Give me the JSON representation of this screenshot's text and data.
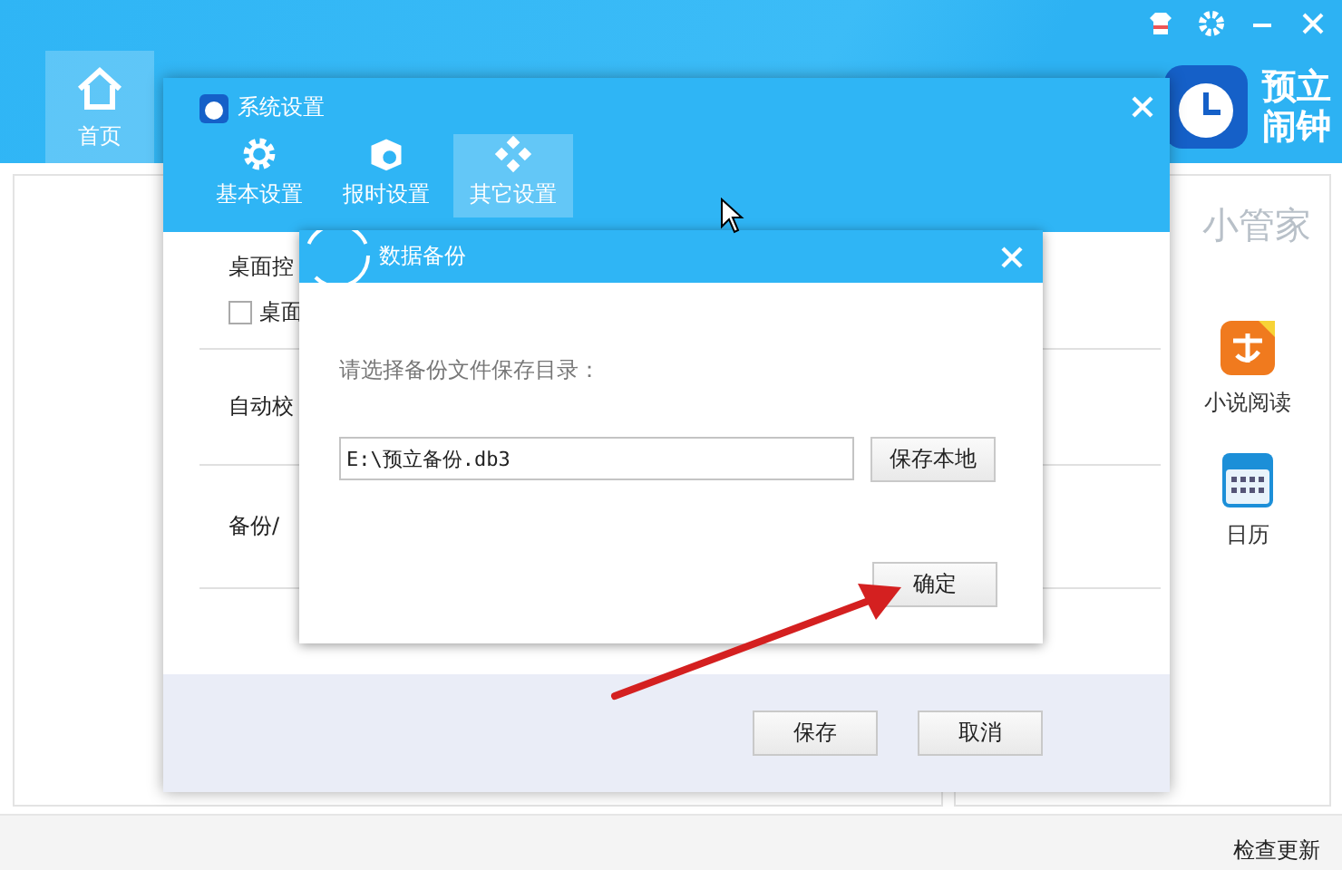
{
  "logo": {
    "lines": [
      "预立",
      "闹钟"
    ]
  },
  "nav": [
    {
      "label": "首页",
      "selected": true
    }
  ],
  "sidebar": {
    "title": "小管家",
    "apps": [
      {
        "kind": "novel",
        "label": "小说阅读"
      },
      {
        "kind": "calendar",
        "label": "日历"
      }
    ]
  },
  "status_bar": {
    "link": "检查更新"
  },
  "settings_dialog": {
    "title": "系统设置",
    "tabs": [
      {
        "kind": "gear",
        "label": "基本设置",
        "selected": false
      },
      {
        "kind": "cube",
        "label": "报时设置",
        "selected": false
      },
      {
        "kind": "diamonds",
        "label": "其它设置",
        "selected": true
      }
    ],
    "sections": [
      {
        "label": "桌面控",
        "checkbox": {
          "label": "桌面",
          "checked": false
        }
      },
      {
        "label": "自动校"
      },
      {
        "label": "备份/"
      }
    ],
    "buttons": [
      "保存",
      "取消"
    ]
  },
  "backup_dialog": {
    "title": "数据备份",
    "prompt": "请选择备份文件保存目录：",
    "path": "E:\\预立备份.db3",
    "browse_button": "保存本地",
    "ok_button": "确定"
  }
}
